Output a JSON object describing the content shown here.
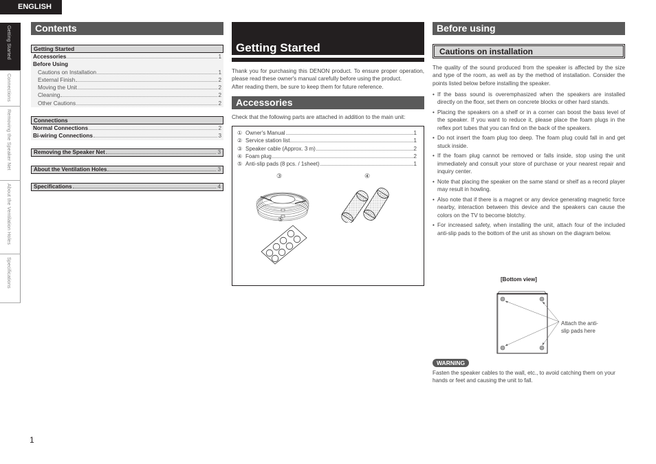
{
  "language_tab": "ENGLISH",
  "side_tabs": [
    {
      "label": "Getting Started",
      "active": true
    },
    {
      "label": "Connections",
      "active": false
    },
    {
      "label": "Removing the Speaker Net",
      "active": false
    },
    {
      "label": "About the Ventilation Holes",
      "active": false
    },
    {
      "label": "Specifications",
      "active": false
    }
  ],
  "contents": {
    "title": "Contents",
    "groups": [
      {
        "header": "Getting Started",
        "items": [
          {
            "label": "Accessories",
            "page": "1",
            "style": "bold"
          },
          {
            "label": "Before Using",
            "page": "",
            "style": "bold"
          },
          {
            "label": "Cautions on Installation",
            "page": "1",
            "style": "sub"
          },
          {
            "label": "External Finish",
            "page": "2",
            "style": "sub"
          },
          {
            "label": "Moving the Unit",
            "page": "2",
            "style": "sub"
          },
          {
            "label": "Cleaning",
            "page": "2",
            "style": "sub"
          },
          {
            "label": "Other Cautions",
            "page": "2",
            "style": "sub"
          }
        ]
      },
      {
        "header": "Connections",
        "items": [
          {
            "label": "Normal Connections",
            "page": "2",
            "style": "bold"
          },
          {
            "label": "Bi-wiring Connections",
            "page": "3",
            "style": "bold"
          }
        ]
      }
    ],
    "singles": [
      {
        "label": "Removing the Speaker Net",
        "page": "3"
      },
      {
        "label": "About the Ventilation Holes",
        "page": "3"
      },
      {
        "label": "Specifications",
        "page": "4"
      }
    ]
  },
  "getting_started": {
    "title": "Getting Started",
    "intro": "Thank you for purchasing this DENON product. To ensure proper operation, please read these owner's manual carefully before using the product.",
    "intro2": "After reading them, be sure to keep them for future reference."
  },
  "accessories": {
    "title": "Accessories",
    "text": "Check that the following parts are attached in addition to the main unit:",
    "items": [
      {
        "num": "①",
        "label": "Owner's Manual",
        "qty": "1"
      },
      {
        "num": "②",
        "label": "Service station list",
        "qty": "1"
      },
      {
        "num": "③",
        "label": "Speaker cable (Approx. 3 m)",
        "qty": "2"
      },
      {
        "num": "④",
        "label": "Foam plug",
        "qty": "2"
      },
      {
        "num": "⑤",
        "label": "Anti-slip pads (8 pcs. / 1sheet)",
        "qty": "1"
      }
    ],
    "illustration_labels": {
      "cable": "③",
      "foam": "④",
      "pads": "⑤"
    }
  },
  "before_using": {
    "title": "Before using",
    "subtitle": "Cautions on installation",
    "lead": "The quality of the sound produced from the speaker is affected by the size and type of the room, as well as by the method of installation. Consider the points listed below before installing the speaker.",
    "bullets": [
      "If the bass sound is overemphasized when the speakers are installed directly on the floor, set them on concrete blocks or other hard stands.",
      "Placing the speakers on a shelf or in a corner can boost the bass level of the speaker. If you want to reduce it, please place the foam plugs in the reflex port tubes that you can find on the back of the speakers.",
      "Do not insert the foam plug too deep. The foam plug could fall in and get stuck inside.",
      "If the foam plug cannot be removed or falls inside, stop using the unit immediately and consult your store of purchase or your nearest repair and inquiry center.",
      "Note that placing the speaker on the same stand or shelf as a record player may result in howling.",
      "Also note that if there is a magnet or any device generating magnetic force nearby, interaction between this device and the speakers can cause the colors on the TV to become blotchy.",
      "For increased safety, when installing the unit, attach four of the included anti-slip pads to the bottom of the unit as shown on the diagram below."
    ],
    "bottom_view_label": "[Bottom view]",
    "pad_callout_line1": "Attach the anti-",
    "pad_callout_line2": "slip pads here",
    "warning_badge": "WARNING",
    "warning_text": "Fasten the speaker cables to the wall, etc., to avoid catching them on your hands or feet and causing the unit to fall."
  },
  "page_number": "1"
}
